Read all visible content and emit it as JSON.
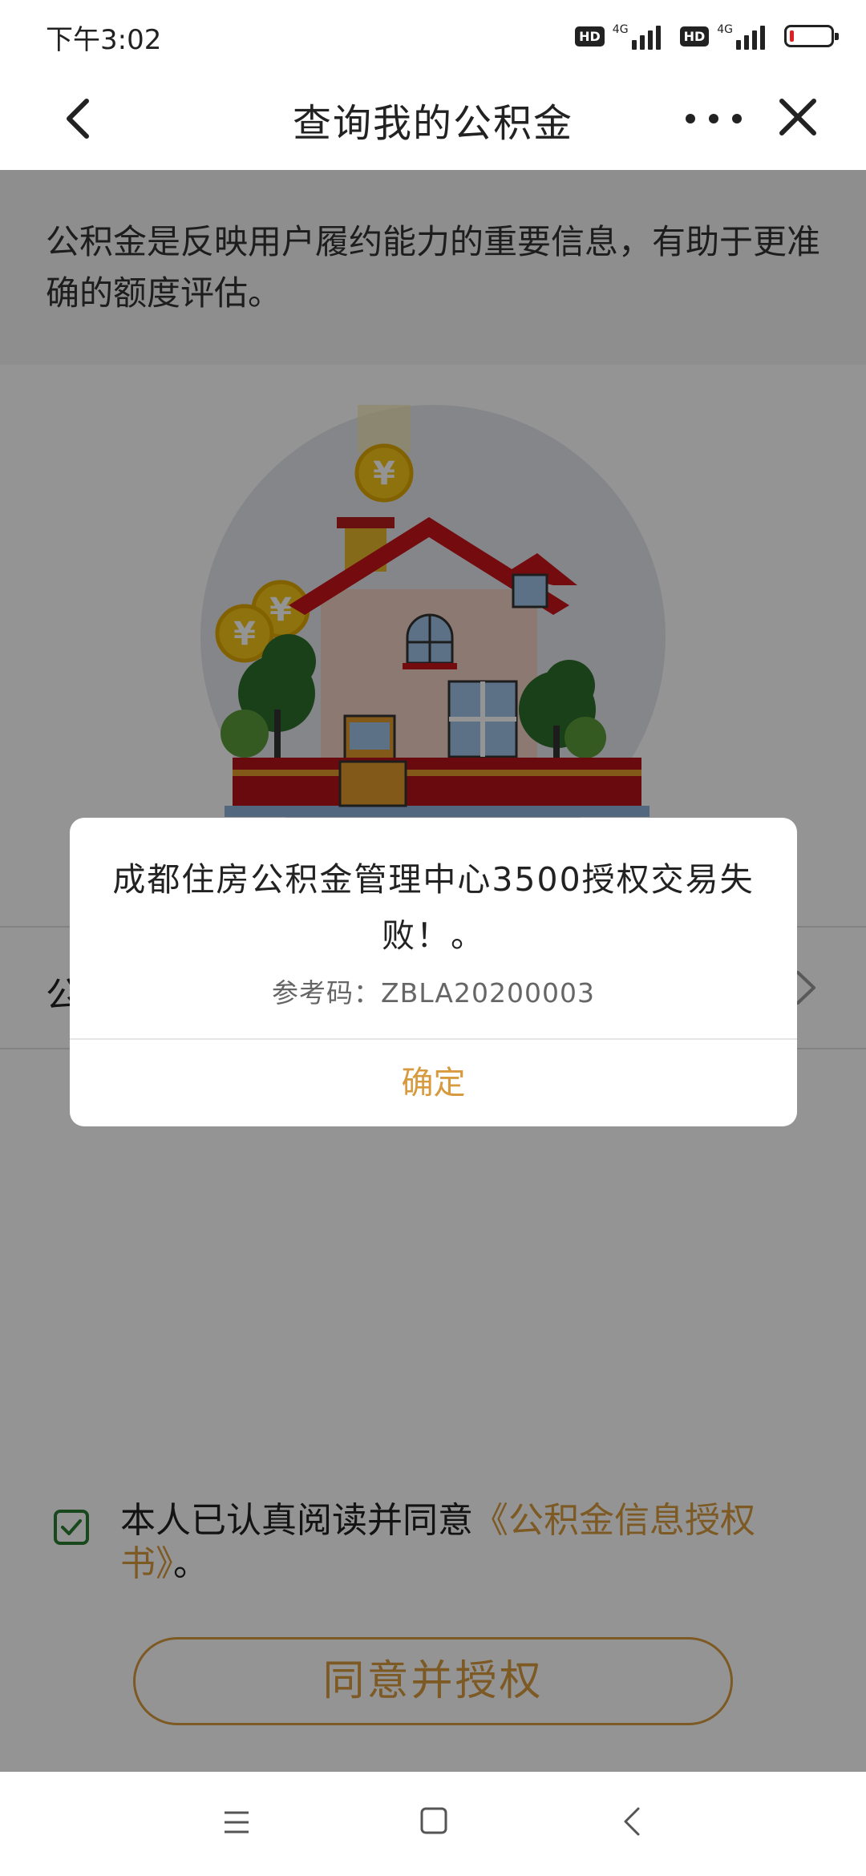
{
  "status_bar": {
    "time": "下午3:02",
    "sim1_badge": "HD",
    "sim1_network": "4G",
    "sim2_badge": "HD",
    "sim2_network": "4G",
    "battery_level_fraction": 0.1
  },
  "header": {
    "title": "查询我的公积金",
    "back_icon": "chevron-left-icon",
    "more_icon": "more-horizontal-icon",
    "close_icon": "close-icon"
  },
  "intro": {
    "text": "公积金是反映用户履约能力的重要信息，有助于更准确的额度评估。"
  },
  "row": {
    "label": "公"
  },
  "agreement": {
    "checked": true,
    "text": "本人已认真阅读并同意",
    "link": "《公积金信息授权书》",
    "suffix": "。"
  },
  "auth_button": {
    "label": "同意并授权"
  },
  "dialog": {
    "message": "成都住房公积金管理中心3500授权交易失败！。",
    "reference_label": "参考码：",
    "reference_code": "ZBLA20200003",
    "confirm_label": "确定"
  },
  "colors": {
    "accent": "#d79a3f",
    "checkbox": "#2e7d32",
    "battery_low": "#e02020"
  }
}
